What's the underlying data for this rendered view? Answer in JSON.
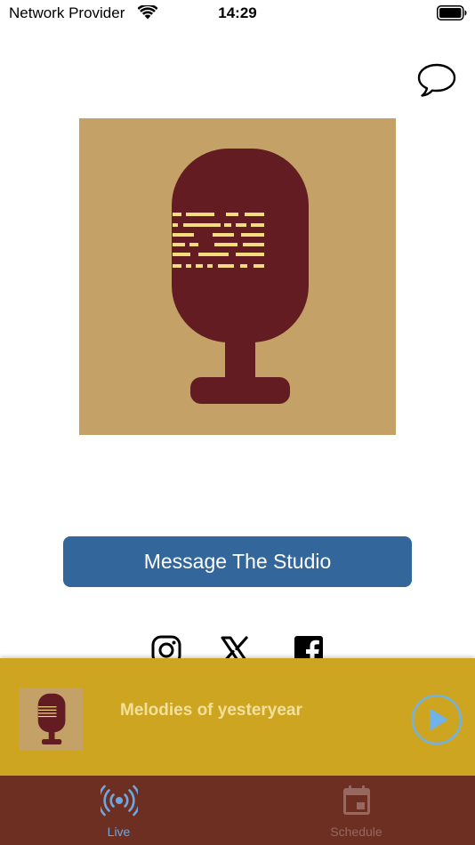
{
  "status_bar": {
    "carrier": "Network Provider",
    "time": "14:29",
    "wifi_icon": "wifi-icon",
    "battery_icon": "battery-icon"
  },
  "header": {
    "chat_icon": "speech-bubble-icon"
  },
  "artwork": {
    "icon": "microphone-icon",
    "background_color": "#c4a267",
    "mic_color": "#621c22",
    "accent_color": "#f5dc7f"
  },
  "message_button": {
    "label": "Message The Studio",
    "color": "#33669a"
  },
  "social": {
    "icons": [
      "instagram-icon",
      "x-icon",
      "facebook-icon"
    ]
  },
  "player": {
    "title": "Melodies of yesteryear",
    "background_color": "#cda520",
    "play_icon": "play-icon"
  },
  "tabs": [
    {
      "label": "Live",
      "icon": "broadcast-icon",
      "active": true
    },
    {
      "label": "Schedule",
      "icon": "calendar-icon",
      "active": false
    }
  ],
  "colors": {
    "tab_bar": "#6e2f23",
    "tab_active": "#6fa8e0",
    "tab_inactive": "#96685f"
  }
}
